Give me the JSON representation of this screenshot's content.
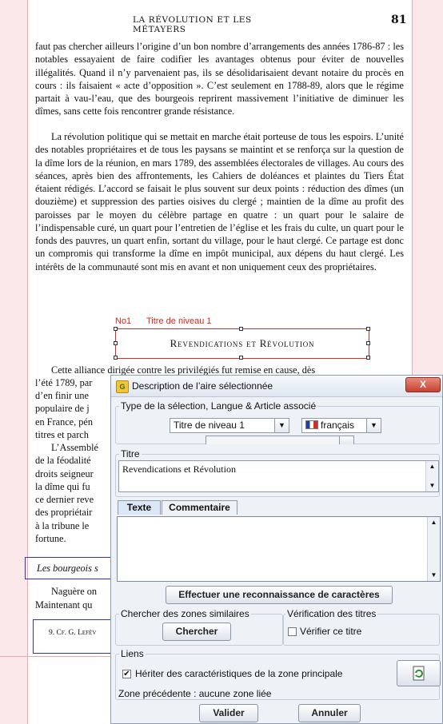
{
  "document": {
    "running_header": "LA RÉVOLUTION ET LES MÉTAYERS",
    "page_number": "81",
    "para1": "faut pas chercher ailleurs l’origine d’un bon nombre d’arrangements des années 1786-87 : les notables essayaient de faire codifier les avantages obtenus pour éviter de nouvelles illégalités. Quand il n’y parvenaient pas, ils se désolidarisaient devant notaire du procès en cours : ils faisaient « acte d’opposition ». C’est seulement en 1788-89, alors que le régime partait à vau-l’eau, que des bourgeois reprirent massivement l’initiative de diminuer les dîmes, sans cette fois rencontrer grande résistance.",
    "para2": "La révolution politique qui se mettait en marche était porteuse de tous les espoirs. L’unité des notables propriétaires et de tous les paysans se maintint et se renforça sur la question de la dîme lors de la réunion, en mars 1789, des assemblées électorales de villages. Au cours des séances, après bien des affrontements, les Cahiers de doléances et plaintes du Tiers État étaient rédigés. L’accord se faisait le plus souvent sur deux points : réduction des dîmes (un douzième) et suppression des parties oisives du clergé ; maintien de la dîme au profit des paroisses par le moyen du célèbre partage en quatre : un quart pour le salaire de l’indispensable curé, un quart pour l’entretien de l’église et les frais du culte, un quart pour le fonds des pauvres, un quart enfin, sortant du village, pour le haut clergé. Ce partage est donc un compromis qui transforme la dîme en impôt municipal, aux dépens du haut clergé. Les intérêts de la communauté sont mis en avant et non uniquement ceux des propriétaires.",
    "zone_id": "No1",
    "zone_type_label": "Titre de niveau 1",
    "section_title": "Revendications et Révolution",
    "para3_line1": "Cette alliance dirigée contre les privilégiés fut remise en cause, dès",
    "left_fragments": [
      "l’été 1789, par",
      "d’en finir une",
      "populaire de j",
      "en France, pén",
      "titres et parch",
      "L’Assemblé",
      "de la féodalité",
      "droits seigneur",
      "la dîme qui fu",
      "ce dernier reve",
      "des propriétair",
      "à la tribune le",
      "fortune."
    ],
    "subtitle_fragment": "Les bourgeois s",
    "left_fragments2": [
      "Naguère on",
      "Maintenant qu"
    ],
    "footnote_fragment": "9. Cf. G. Lefèv"
  },
  "dialog": {
    "title": "Description de l’aire sélectionnée",
    "close_label": "X",
    "group_type_label": "Type de la sélection, Langue & Article associé",
    "type_select": "Titre de niveau 1",
    "language_select": "français",
    "title_group_label": "Titre",
    "title_text": "Revendications et Révolution",
    "tab_text": "Texte",
    "tab_comment": "Commentaire",
    "body_text": "",
    "ocr_button": "Effectuer une reconnaissance de caractères",
    "similar_group_label": "Chercher des zones similaires",
    "search_button": "Chercher",
    "verify_group_label": "Vérification des titres",
    "verify_checkbox_label": "Vérifier ce titre",
    "links_group_label": "Liens",
    "inherit_checkbox_label": "Hériter des caractéristiques de la zone principale",
    "prev_zone_text": "Zone précédente : aucune zone liée",
    "validate_button": "Valider",
    "cancel_button": "Annuler"
  }
}
